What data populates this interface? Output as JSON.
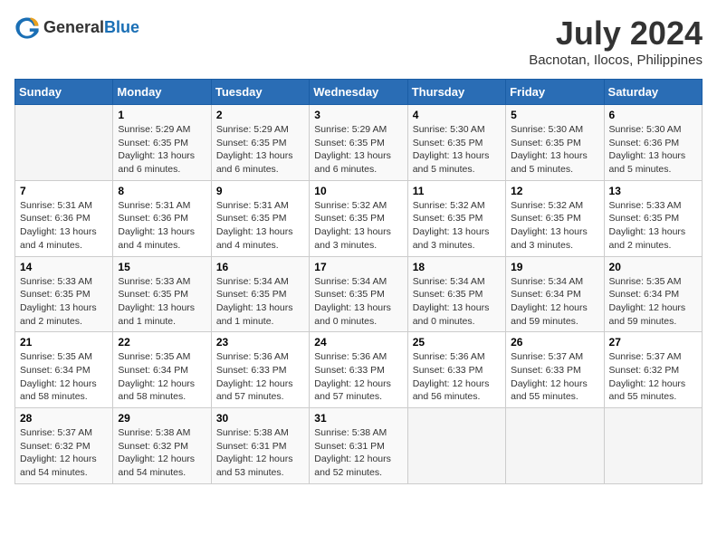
{
  "header": {
    "logo_general": "General",
    "logo_blue": "Blue",
    "month_year": "July 2024",
    "location": "Bacnotan, Ilocos, Philippines"
  },
  "weekdays": [
    "Sunday",
    "Monday",
    "Tuesday",
    "Wednesday",
    "Thursday",
    "Friday",
    "Saturday"
  ],
  "weeks": [
    [
      {
        "num": "",
        "info": ""
      },
      {
        "num": "1",
        "info": "Sunrise: 5:29 AM\nSunset: 6:35 PM\nDaylight: 13 hours\nand 6 minutes."
      },
      {
        "num": "2",
        "info": "Sunrise: 5:29 AM\nSunset: 6:35 PM\nDaylight: 13 hours\nand 6 minutes."
      },
      {
        "num": "3",
        "info": "Sunrise: 5:29 AM\nSunset: 6:35 PM\nDaylight: 13 hours\nand 6 minutes."
      },
      {
        "num": "4",
        "info": "Sunrise: 5:30 AM\nSunset: 6:35 PM\nDaylight: 13 hours\nand 5 minutes."
      },
      {
        "num": "5",
        "info": "Sunrise: 5:30 AM\nSunset: 6:35 PM\nDaylight: 13 hours\nand 5 minutes."
      },
      {
        "num": "6",
        "info": "Sunrise: 5:30 AM\nSunset: 6:36 PM\nDaylight: 13 hours\nand 5 minutes."
      }
    ],
    [
      {
        "num": "7",
        "info": "Sunrise: 5:31 AM\nSunset: 6:36 PM\nDaylight: 13 hours\nand 4 minutes."
      },
      {
        "num": "8",
        "info": "Sunrise: 5:31 AM\nSunset: 6:36 PM\nDaylight: 13 hours\nand 4 minutes."
      },
      {
        "num": "9",
        "info": "Sunrise: 5:31 AM\nSunset: 6:35 PM\nDaylight: 13 hours\nand 4 minutes."
      },
      {
        "num": "10",
        "info": "Sunrise: 5:32 AM\nSunset: 6:35 PM\nDaylight: 13 hours\nand 3 minutes."
      },
      {
        "num": "11",
        "info": "Sunrise: 5:32 AM\nSunset: 6:35 PM\nDaylight: 13 hours\nand 3 minutes."
      },
      {
        "num": "12",
        "info": "Sunrise: 5:32 AM\nSunset: 6:35 PM\nDaylight: 13 hours\nand 3 minutes."
      },
      {
        "num": "13",
        "info": "Sunrise: 5:33 AM\nSunset: 6:35 PM\nDaylight: 13 hours\nand 2 minutes."
      }
    ],
    [
      {
        "num": "14",
        "info": "Sunrise: 5:33 AM\nSunset: 6:35 PM\nDaylight: 13 hours\nand 2 minutes."
      },
      {
        "num": "15",
        "info": "Sunrise: 5:33 AM\nSunset: 6:35 PM\nDaylight: 13 hours\nand 1 minute."
      },
      {
        "num": "16",
        "info": "Sunrise: 5:34 AM\nSunset: 6:35 PM\nDaylight: 13 hours\nand 1 minute."
      },
      {
        "num": "17",
        "info": "Sunrise: 5:34 AM\nSunset: 6:35 PM\nDaylight: 13 hours\nand 0 minutes."
      },
      {
        "num": "18",
        "info": "Sunrise: 5:34 AM\nSunset: 6:35 PM\nDaylight: 13 hours\nand 0 minutes."
      },
      {
        "num": "19",
        "info": "Sunrise: 5:34 AM\nSunset: 6:34 PM\nDaylight: 12 hours\nand 59 minutes."
      },
      {
        "num": "20",
        "info": "Sunrise: 5:35 AM\nSunset: 6:34 PM\nDaylight: 12 hours\nand 59 minutes."
      }
    ],
    [
      {
        "num": "21",
        "info": "Sunrise: 5:35 AM\nSunset: 6:34 PM\nDaylight: 12 hours\nand 58 minutes."
      },
      {
        "num": "22",
        "info": "Sunrise: 5:35 AM\nSunset: 6:34 PM\nDaylight: 12 hours\nand 58 minutes."
      },
      {
        "num": "23",
        "info": "Sunrise: 5:36 AM\nSunset: 6:33 PM\nDaylight: 12 hours\nand 57 minutes."
      },
      {
        "num": "24",
        "info": "Sunrise: 5:36 AM\nSunset: 6:33 PM\nDaylight: 12 hours\nand 57 minutes."
      },
      {
        "num": "25",
        "info": "Sunrise: 5:36 AM\nSunset: 6:33 PM\nDaylight: 12 hours\nand 56 minutes."
      },
      {
        "num": "26",
        "info": "Sunrise: 5:37 AM\nSunset: 6:33 PM\nDaylight: 12 hours\nand 55 minutes."
      },
      {
        "num": "27",
        "info": "Sunrise: 5:37 AM\nSunset: 6:32 PM\nDaylight: 12 hours\nand 55 minutes."
      }
    ],
    [
      {
        "num": "28",
        "info": "Sunrise: 5:37 AM\nSunset: 6:32 PM\nDaylight: 12 hours\nand 54 minutes."
      },
      {
        "num": "29",
        "info": "Sunrise: 5:38 AM\nSunset: 6:32 PM\nDaylight: 12 hours\nand 54 minutes."
      },
      {
        "num": "30",
        "info": "Sunrise: 5:38 AM\nSunset: 6:31 PM\nDaylight: 12 hours\nand 53 minutes."
      },
      {
        "num": "31",
        "info": "Sunrise: 5:38 AM\nSunset: 6:31 PM\nDaylight: 12 hours\nand 52 minutes."
      },
      {
        "num": "",
        "info": ""
      },
      {
        "num": "",
        "info": ""
      },
      {
        "num": "",
        "info": ""
      }
    ]
  ]
}
